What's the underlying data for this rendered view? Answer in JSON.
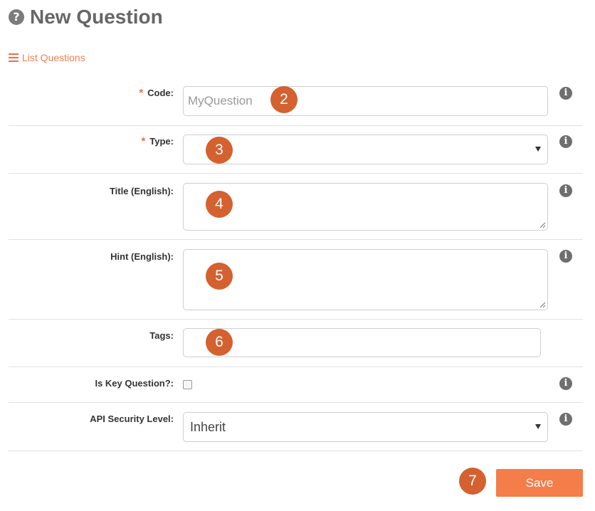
{
  "header": {
    "title": "New Question",
    "help_icon": "question-circle-icon"
  },
  "nav": {
    "list_link_label": "List Questions",
    "list_icon": "list-icon"
  },
  "form": {
    "required_marker": "*",
    "code": {
      "label": "Code:",
      "placeholder": "MyQuestion",
      "value": ""
    },
    "type": {
      "label": "Type:",
      "selected": ""
    },
    "title": {
      "label": "Title (English):",
      "value": ""
    },
    "hint": {
      "label": "Hint (English):",
      "value": ""
    },
    "tags": {
      "label": "Tags:",
      "value": ""
    },
    "is_key": {
      "label": "Is Key Question?:",
      "checked": false
    },
    "api_security": {
      "label": "API Security Level:",
      "selected": "Inherit"
    },
    "info_glyph": "i"
  },
  "callouts": [
    "2",
    "3",
    "4",
    "5",
    "6",
    "7"
  ],
  "actions": {
    "save_label": "Save"
  },
  "colors": {
    "accent": "#f47d4a",
    "callout": "#d4612f",
    "link": "#f08050",
    "title": "#666666"
  }
}
